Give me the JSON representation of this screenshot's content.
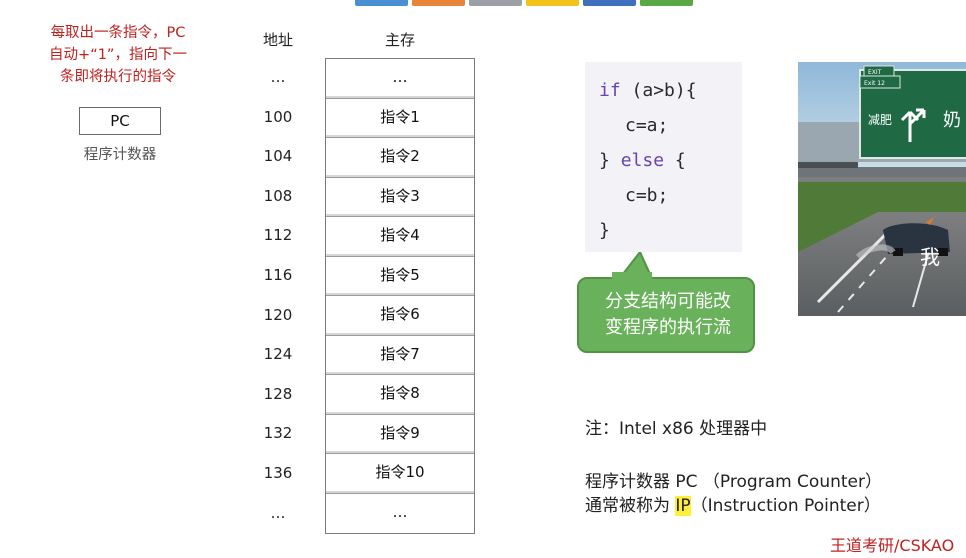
{
  "topbar": {
    "colors": [
      "#4a8fd1",
      "#e9843a",
      "#9aa0a6",
      "#f2c21b",
      "#3f6fbf",
      "#58a848"
    ]
  },
  "pc_note": {
    "line1": "每取出一条指令，PC",
    "line2": "自动+“1”，指向下一",
    "line3": "条即将执行的指令"
  },
  "pc_box": {
    "label": "PC",
    "caption": "程序计数器"
  },
  "memory": {
    "addr_header": "地址",
    "mem_header": "主存",
    "rows": [
      {
        "addr": "…",
        "content": "…"
      },
      {
        "addr": "100",
        "content": "指令1"
      },
      {
        "addr": "104",
        "content": "指令2"
      },
      {
        "addr": "108",
        "content": "指令3"
      },
      {
        "addr": "112",
        "content": "指令4"
      },
      {
        "addr": "116",
        "content": "指令5"
      },
      {
        "addr": "120",
        "content": "指令6"
      },
      {
        "addr": "124",
        "content": "指令7"
      },
      {
        "addr": "128",
        "content": "指令8"
      },
      {
        "addr": "132",
        "content": "指令9"
      },
      {
        "addr": "136",
        "content": "指令10"
      },
      {
        "addr": "…",
        "content": "…"
      }
    ]
  },
  "code": {
    "l1_kw": "if",
    "l1_rest": " (a>b){",
    "l2": "c=a;",
    "l3_a": "} ",
    "l3_kw": "else",
    "l3_b": " {",
    "l4": "c=b;",
    "l5": "}"
  },
  "bubble": {
    "line1": "分支结构可能改",
    "line2": "变程序的执行流"
  },
  "photo": {
    "sign_text": "减肥",
    "sign_text2": "奶",
    "caption": "我",
    "sign_small": "Exit 12"
  },
  "notes": {
    "line1": "注：Intel x86 处理器中",
    "line2": "程序计数器 PC （Program Counter）",
    "line3_a": "通常被称为 ",
    "line3_hl": "IP",
    "line3_b": "（Instruction Pointer）"
  },
  "brand": "王道考研/CSKAO"
}
